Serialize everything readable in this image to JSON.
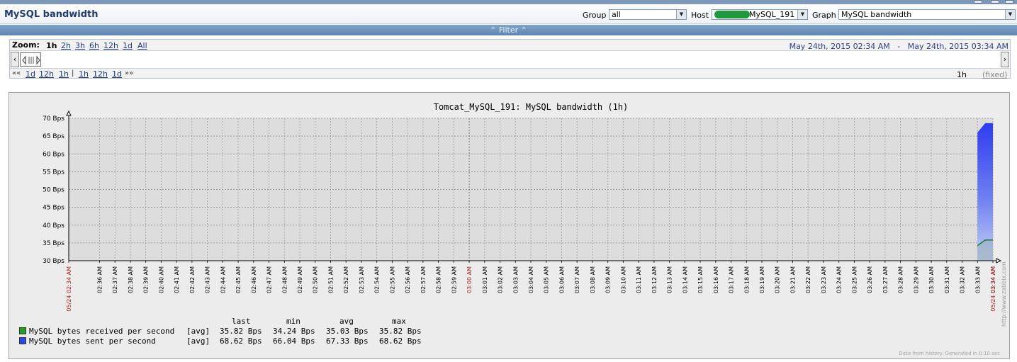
{
  "header": {
    "title": "MySQL bandwidth",
    "group_label": "Group",
    "group_value": "all",
    "host_label": "Host",
    "host_value": "MySQL_191",
    "graph_label": "Graph",
    "graph_value": "MySQL bandwidth"
  },
  "filter": {
    "label": "⌃ Filter ⌃"
  },
  "zoom": {
    "label": "Zoom:",
    "options": [
      "1h",
      "2h",
      "3h",
      "6h",
      "12h",
      "1d",
      "All"
    ],
    "active": "1h",
    "from": "May 24th, 2015 02:34 AM",
    "separator": "-",
    "to": "May 24th, 2015 03:34 AM",
    "nav_back": [
      "1d",
      "12h",
      "1h"
    ],
    "nav_fwd": [
      "1h",
      "12h",
      "1d"
    ],
    "period": "1h",
    "fixed": "(fixed)"
  },
  "chart_data": {
    "type": "area",
    "title": "Tomcat_MySQL_191: MySQL bandwidth (1h)",
    "y_unit": "Bps",
    "ylim": [
      30,
      70
    ],
    "y_ticks": [
      "30 Bps",
      "35 Bps",
      "40 Bps",
      "45 Bps",
      "50 Bps",
      "55 Bps",
      "60 Bps",
      "65 Bps",
      "70 Bps"
    ],
    "x_start_label": "05/24 02:34 AM",
    "x_end_label": "05/24 03:34 AM",
    "x_ticks": [
      "02:36 AM",
      "02:37 AM",
      "02:38 AM",
      "02:39 AM",
      "02:40 AM",
      "02:41 AM",
      "02:42 AM",
      "02:43 AM",
      "02:44 AM",
      "02:45 AM",
      "02:46 AM",
      "02:47 AM",
      "02:48 AM",
      "02:49 AM",
      "02:50 AM",
      "02:51 AM",
      "02:52 AM",
      "02:53 AM",
      "02:54 AM",
      "02:55 AM",
      "02:56 AM",
      "02:57 AM",
      "02:58 AM",
      "02:59 AM",
      "03:00 AM",
      "03:01 AM",
      "03:02 AM",
      "03:03 AM",
      "03:04 AM",
      "03:05 AM",
      "03:06 AM",
      "03:07 AM",
      "03:08 AM",
      "03:09 AM",
      "03:10 AM",
      "03:11 AM",
      "03:12 AM",
      "03:13 AM",
      "03:14 AM",
      "03:15 AM",
      "03:16 AM",
      "03:17 AM",
      "03:18 AM",
      "03:19 AM",
      "03:20 AM",
      "03:21 AM",
      "03:22 AM",
      "03:23 AM",
      "03:24 AM",
      "03:25 AM",
      "03:26 AM",
      "03:27 AM",
      "03:28 AM",
      "03:29 AM",
      "03:30 AM",
      "03:31 AM",
      "03:32 AM",
      "03:33 AM",
      "03:34 AM"
    ],
    "highlight_tick": "03:00 AM",
    "series": [
      {
        "name": "MySQL bytes received per second",
        "color": "#1a9a1a",
        "x": [
          "03:33 AM",
          "03:33:30 AM",
          "03:34 AM"
        ],
        "values": [
          34.24,
          35.82,
          35.82
        ]
      },
      {
        "name": "MySQL bytes sent per second",
        "color": "#2f3cf0",
        "x": [
          "03:33 AM",
          "03:33:30 AM",
          "03:34 AM"
        ],
        "values": [
          66.04,
          68.62,
          68.62
        ]
      }
    ],
    "grid": true,
    "legend_position": "bottom-left",
    "watermark": "http://www.zabbix.com",
    "footer": "Data from history. Generated in 0.10 sec"
  },
  "legend": {
    "headers": [
      "last",
      "min",
      "avg",
      "max"
    ],
    "rows": [
      {
        "name": "MySQL bytes received per second",
        "func": "[avg]",
        "last": "35.82 Bps",
        "min": "34.24 Bps",
        "avg": "35.03 Bps",
        "max": "35.82 Bps",
        "color": "#22a022"
      },
      {
        "name": "MySQL bytes sent per second",
        "func": "[avg]",
        "last": "68.62 Bps",
        "min": "66.04 Bps",
        "avg": "67.33 Bps",
        "max": "68.62 Bps",
        "color": "#3344ee"
      }
    ]
  }
}
